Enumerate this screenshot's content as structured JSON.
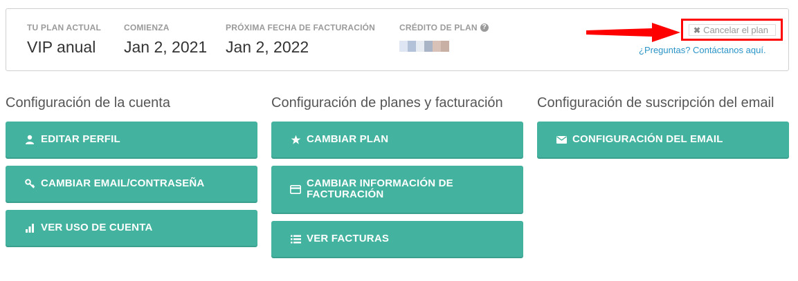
{
  "plan": {
    "current_label": "TU PLAN ACTUAL",
    "current_value": "VIP anual",
    "start_label": "COMIENZA",
    "start_value": "Jan 2, 2021",
    "next_label": "PRÓXIMA FECHA DE FACTURACIÓN",
    "next_value": "Jan 2, 2022",
    "credit_label": "CRÉDITO DE PLAN",
    "credit_help_icon": "?",
    "cancel_icon": "✖",
    "cancel_label": "Cancelar el plan",
    "contact_link": "¿Preguntas? Contáctanos aquí."
  },
  "sections": {
    "account_title": "Configuración de la cuenta",
    "billing_title": "Configuración de planes y facturación",
    "email_title": "Configuración de suscripción del email"
  },
  "buttons": {
    "edit_profile": "EDITAR PERFIL",
    "change_email": "CAMBIAR EMAIL/CONTRASEÑA",
    "usage": "VER USO DE CUENTA",
    "change_plan": "CAMBIAR PLAN",
    "billing_info_line1": "CAMBIAR INFORMACIÓN DE",
    "billing_info_line2": "FACTURACIÓN",
    "invoices": "VER FACTURAS",
    "email_config": "CONFIGURACIÓN DEL EMAIL"
  },
  "colors": {
    "accent": "#43b29f",
    "link": "#2a94c7",
    "highlight": "#ff0000"
  }
}
